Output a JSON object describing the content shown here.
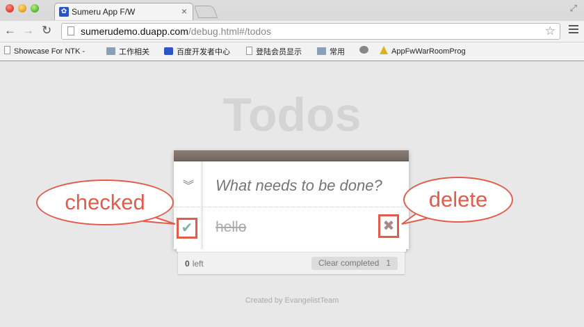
{
  "browser": {
    "tab_title": "Sumeru App F/W",
    "tab_close": "×",
    "url_host": "sumerudemo.duapp.com",
    "url_path": "/debug.html#/todos"
  },
  "bookmarks": [
    {
      "label": "Showcase For NTK -",
      "icon": "page-icon"
    },
    {
      "label": "工作相关",
      "icon": "folder-icon"
    },
    {
      "label": "百度开发者中心",
      "icon": "paw-icon"
    },
    {
      "label": "登陆会员显示",
      "icon": "page-icon"
    },
    {
      "label": "常用",
      "icon": "folder-icon"
    },
    {
      "label": "",
      "icon": "globe-icon"
    },
    {
      "label": "AppFwWarRoomProg",
      "icon": "warning-icon"
    }
  ],
  "app": {
    "title": "Todos",
    "new_todo_placeholder": "What needs to be done?",
    "todos": [
      {
        "label": "hello",
        "completed": true
      }
    ],
    "footer": {
      "count": "0",
      "count_label": "left",
      "clear_label": "Clear completed",
      "clear_count": "1"
    },
    "credit": "Created by EvangelistTeam"
  },
  "annotations": {
    "checked_label": "checked",
    "delete_label": "delete",
    "color": "#e25c4c"
  }
}
